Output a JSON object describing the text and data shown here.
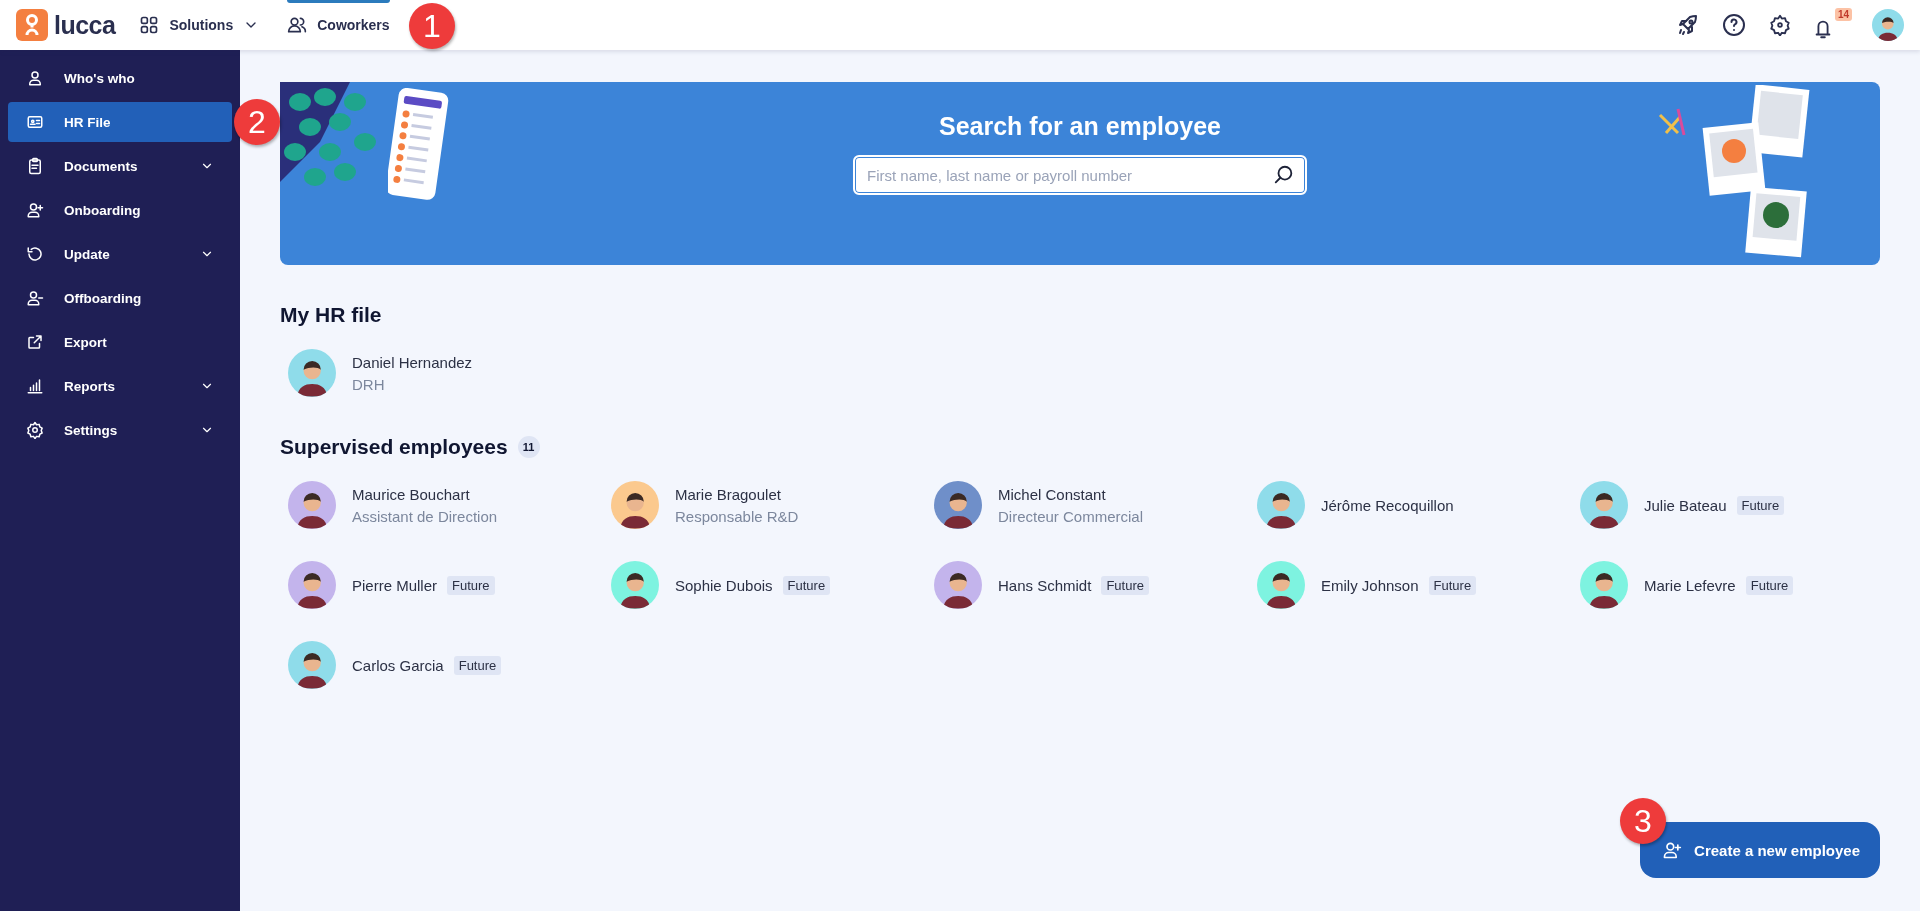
{
  "topbar": {
    "logo": "lucca",
    "nav": [
      {
        "label": "Solutions",
        "selected": false,
        "dropdown": true
      },
      {
        "label": "Coworkers",
        "selected": true,
        "dropdown": false
      }
    ],
    "notifications": "14"
  },
  "sidebar": {
    "items": [
      {
        "label": "Who's who",
        "selected": false,
        "expandable": false
      },
      {
        "label": "HR File",
        "selected": true,
        "expandable": false
      },
      {
        "label": "Documents",
        "selected": false,
        "expandable": true
      },
      {
        "label": "Onboarding",
        "selected": false,
        "expandable": false
      },
      {
        "label": "Update",
        "selected": false,
        "expandable": true
      },
      {
        "label": "Offboarding",
        "selected": false,
        "expandable": false
      },
      {
        "label": "Export",
        "selected": false,
        "expandable": false
      },
      {
        "label": "Reports",
        "selected": false,
        "expandable": true
      },
      {
        "label": "Settings",
        "selected": false,
        "expandable": true
      }
    ]
  },
  "banner": {
    "title": "Search for an employee",
    "search": {
      "placeholder": "First name, last name or payroll number"
    }
  },
  "my_hr_file": {
    "title": "My HR file",
    "employee": {
      "name": "Daniel Hernandez",
      "role": "DRH",
      "color": "#8fdcea"
    }
  },
  "supervised": {
    "title": "Supervised employees",
    "count": "11",
    "employees": [
      {
        "name": "Maurice Bouchart",
        "role": "Assistant de Direction",
        "color": "#c3b4ec"
      },
      {
        "name": "Marie Bragoulet",
        "role": "Responsable R&D",
        "color": "#fbc98e"
      },
      {
        "name": "Michel Constant",
        "role": "Directeur Commercial",
        "color": "#6f8fc9"
      },
      {
        "name": "Jérôme Recoquillon",
        "color": "#8fdcea"
      },
      {
        "name": "Julie Bateau",
        "tag": "Future",
        "color": "#8fdcea"
      },
      {
        "name": "Pierre Muller",
        "tag": "Future",
        "color": "#c3b4ec"
      },
      {
        "name": "Sophie Dubois",
        "tag": "Future",
        "color": "#7ef3e0"
      },
      {
        "name": "Hans Schmidt",
        "tag": "Future",
        "color": "#c3b4ec"
      },
      {
        "name": "Emily Johnson",
        "tag": "Future",
        "color": "#7ef3e0"
      },
      {
        "name": "Marie Lefevre",
        "tag": "Future",
        "color": "#7ef3e0"
      },
      {
        "name": "Carlos Garcia",
        "tag": "Future",
        "color": "#8fdcea"
      }
    ]
  },
  "create_button": "Create a new employee",
  "callouts": [
    "1",
    "2",
    "3"
  ]
}
